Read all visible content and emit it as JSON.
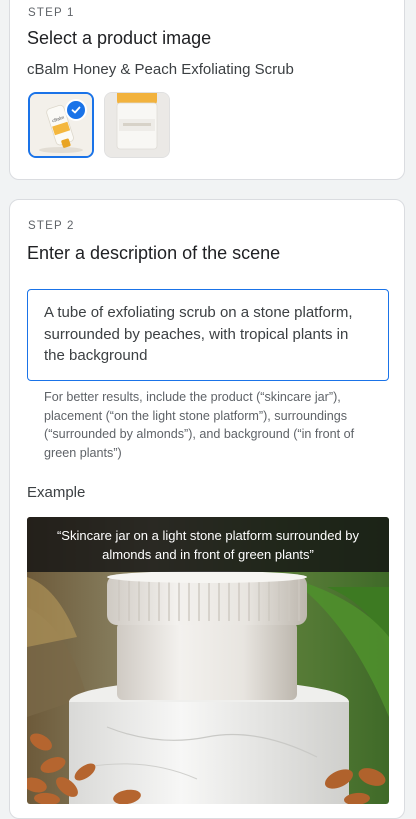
{
  "step1": {
    "label": "STEP 1",
    "title": "Select a product image",
    "product_name": "cBalm Honey & Peach Exfoliating Scrub"
  },
  "step2": {
    "label": "STEP 2",
    "title": "Enter a description of the scene",
    "description_value": "A tube of exfoliating scrub on a stone platform, surrounded by peaches, with tropical plants in the background",
    "helper_text": "For better results, include the product (“skincare jar”), placement (“on the light stone platform”), surroundings (“surrounded by almonds”), and background (“in front of green plants”)",
    "example_label": "Example",
    "example_caption": "“Skincare jar on a light stone platform surrounded by almonds and in front of green plants”"
  },
  "icons": {
    "selected": "check-icon"
  },
  "colors": {
    "accent": "#1a73e8",
    "page_bg": "#f1f3f4"
  }
}
